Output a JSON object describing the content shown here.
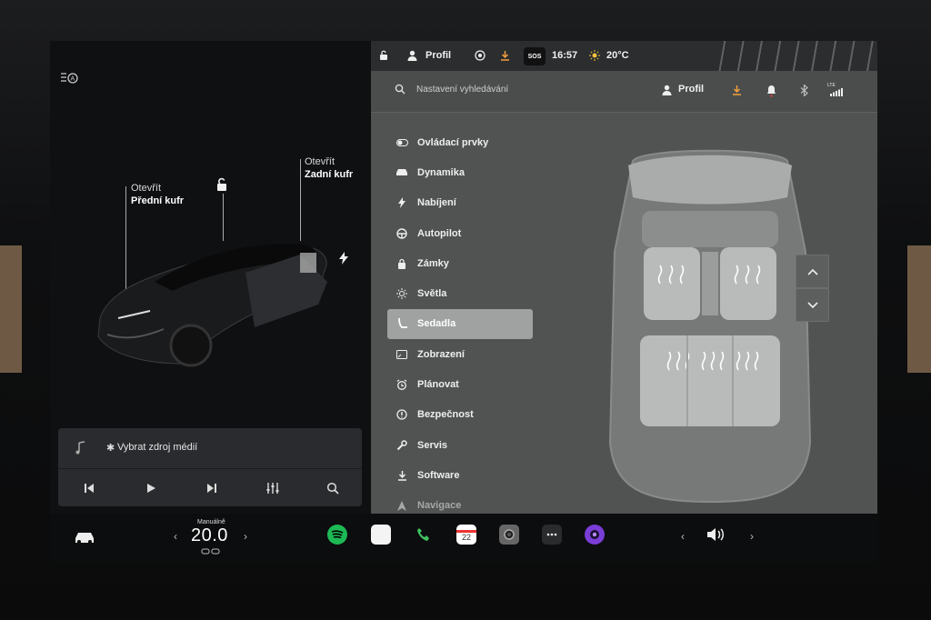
{
  "left": {
    "front_trunk": {
      "action": "Otevřít",
      "name": "Přední kufr"
    },
    "rear_trunk": {
      "action": "Otevřít",
      "name": "Zadní kufr"
    },
    "media": {
      "source_label": "Vybrat zdroj médií"
    }
  },
  "status": {
    "profile": "Profil",
    "time": "16:57",
    "temp": "20°C",
    "sos": "SOS"
  },
  "search": {
    "placeholder": "Nastavení vyhledávání",
    "profile": "Profil",
    "lte": "LTE"
  },
  "menu": {
    "items": [
      {
        "label": "Ovládací prvky",
        "icon": "toggle-icon"
      },
      {
        "label": "Dynamika",
        "icon": "car-icon"
      },
      {
        "label": "Nabíjení",
        "icon": "bolt-icon"
      },
      {
        "label": "Autopilot",
        "icon": "steering-wheel-icon"
      },
      {
        "label": "Zámky",
        "icon": "lock-icon"
      },
      {
        "label": "Světla",
        "icon": "sun-icon"
      },
      {
        "label": "Sedadla",
        "icon": "seat-icon",
        "active": true
      },
      {
        "label": "Zobrazení",
        "icon": "display-icon"
      },
      {
        "label": "Plánovat",
        "icon": "alarm-clock-icon"
      },
      {
        "label": "Bezpečnost",
        "icon": "info-circle-icon"
      },
      {
        "label": "Servis",
        "icon": "wrench-icon"
      },
      {
        "label": "Software",
        "icon": "download-icon"
      },
      {
        "label": "Navigace",
        "icon": "navigation-icon"
      }
    ]
  },
  "dock": {
    "climate_mode": "Manuálně",
    "temperature": "20.0",
    "calendar_day": "22"
  },
  "colors": {
    "accent_orange": "#f2a03d",
    "active_menu": "#9fa2a1"
  }
}
